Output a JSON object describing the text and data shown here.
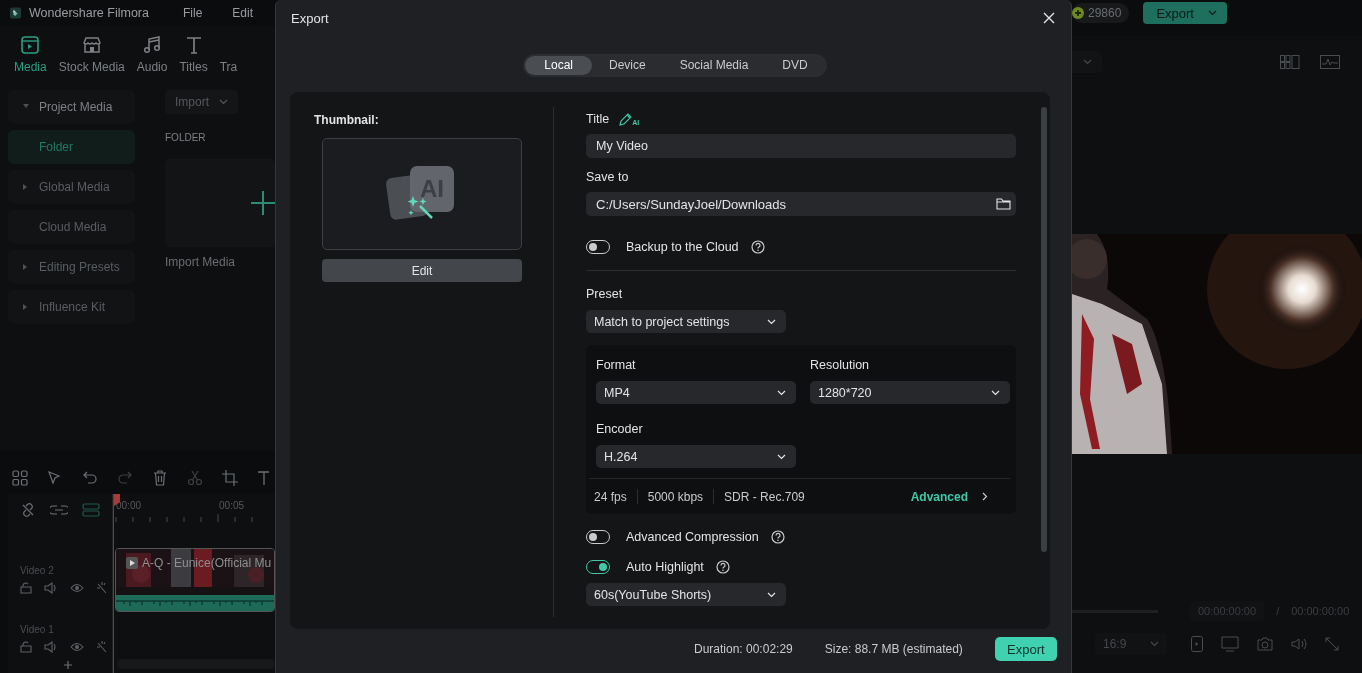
{
  "app": {
    "name": "Wondershare Filmora",
    "menu": [
      "File",
      "Edit"
    ],
    "credits": "29860",
    "export_button": "Export"
  },
  "media_tabs": [
    {
      "label": "Media",
      "selected": true
    },
    {
      "label": "Stock Media",
      "selected": false
    },
    {
      "label": "Audio",
      "selected": false
    },
    {
      "label": "Titles",
      "selected": false
    },
    {
      "label": "Tra",
      "selected": false
    }
  ],
  "media_sidebar": [
    {
      "label": "Project Media",
      "kind": "group",
      "expanded": true,
      "selected": false
    },
    {
      "label": "Folder",
      "kind": "child",
      "selected": true
    },
    {
      "label": "Global Media",
      "kind": "group",
      "expanded": false,
      "selected": false
    },
    {
      "label": "Cloud Media",
      "kind": "item",
      "selected": false
    },
    {
      "label": "Editing Presets",
      "kind": "group",
      "expanded": false,
      "selected": false
    },
    {
      "label": "Influence Kit",
      "kind": "group",
      "expanded": false,
      "selected": false
    }
  ],
  "media_browser": {
    "import_button": "Import",
    "folder_heading": "FOLDER",
    "import_card": "Import Media"
  },
  "timeline": {
    "ruler": [
      "00:00",
      "00:05"
    ],
    "tracks": [
      {
        "name": "Video 2",
        "clip": "A-Q - Eunice(Official Mu"
      },
      {
        "name": "Video 1"
      }
    ]
  },
  "preview": {
    "current_time": "00:00:00:00",
    "separator": "/",
    "total_time": "00:00:00:00",
    "aspect_ratio": "16:9"
  },
  "export_dialog": {
    "title": "Export",
    "tabs": [
      {
        "label": "Local",
        "selected": true
      },
      {
        "label": "Device",
        "selected": false
      },
      {
        "label": "Social Media",
        "selected": false
      },
      {
        "label": "DVD",
        "selected": false
      }
    ],
    "thumbnail": {
      "label": "Thumbnail:",
      "art_text": "AI",
      "edit_button": "Edit"
    },
    "title_field": {
      "label": "Title",
      "badge": "AI",
      "value": "My Video"
    },
    "save_to": {
      "label": "Save to",
      "value": "C:/Users/SundayJoel/Downloads"
    },
    "backup": {
      "label": "Backup to the Cloud",
      "on": false
    },
    "preset": {
      "label": "Preset",
      "value": "Match to project settings"
    },
    "format": {
      "label": "Format",
      "value": "MP4"
    },
    "resolution": {
      "label": "Resolution",
      "value": "1280*720"
    },
    "encoder": {
      "label": "Encoder",
      "value": "H.264"
    },
    "specs": [
      "24 fps",
      "5000 kbps",
      "SDR - Rec.709"
    ],
    "advanced_link": "Advanced",
    "advanced_compression": {
      "label": "Advanced Compression",
      "on": false
    },
    "auto_highlight": {
      "label": "Auto Highlight",
      "on": true,
      "value": "60s(YouTube Shorts)"
    },
    "duration": {
      "label": "Duration:",
      "value": "00:02:29"
    },
    "size": {
      "label": "Size:",
      "value": "88.7 MB",
      "note": "(estimated)"
    },
    "export_button": "Export"
  }
}
